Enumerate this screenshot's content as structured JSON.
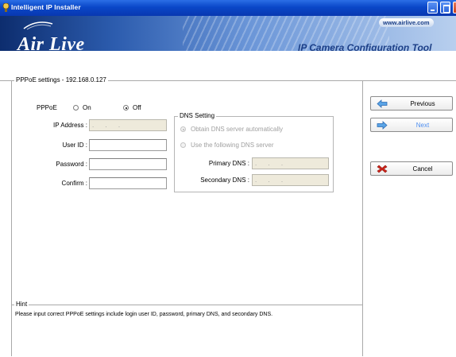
{
  "window": {
    "title": "Intelligent IP Installer",
    "buttons": [
      "minimize",
      "maximize",
      "close"
    ]
  },
  "banner": {
    "logo": "Air Live",
    "url": "www.airlive.com",
    "title": "IP Camera Configuration Tool"
  },
  "pppoe_group": {
    "title": "PPPoE settings - 192.168.0.127",
    "pppoe_label": "PPPoE",
    "on_label": "On",
    "off_label": "Off",
    "selected": "Off",
    "ip_label": "IP Address :",
    "ip_value": ". . .",
    "userid_label": "User ID :",
    "userid_value": "",
    "password_label": "Password :",
    "password_value": "",
    "confirm_label": "Confirm :",
    "confirm_value": ""
  },
  "dns": {
    "title": "DNS Setting",
    "auto_label": "Obtain DNS server automatically",
    "manual_label": "Use the following DNS server",
    "selected": "auto",
    "primary_label": "Primary DNS :",
    "primary_value": ". . .",
    "secondary_label": "Secondary DNS :",
    "secondary_value": ". . ."
  },
  "nav": {
    "previous_label": "Previous",
    "next_label": "Next",
    "cancel_label": "Cancel",
    "icons": [
      "arrow-left-icon",
      "arrow-right-icon",
      "x-icon"
    ]
  },
  "hint": {
    "title": "Hint",
    "text": "Please input correct PPPoE settings include login user ID, password, primary DNS, and secondary DNS."
  },
  "colors": {
    "titlebar": "#0a47c8",
    "banner_dark": "#0d2d6e",
    "banner_light": "#b8cfee",
    "next_text": "#4f8ff0",
    "cancel_icon": "#d4261c",
    "arrow_icon": "#5aa4e6"
  }
}
